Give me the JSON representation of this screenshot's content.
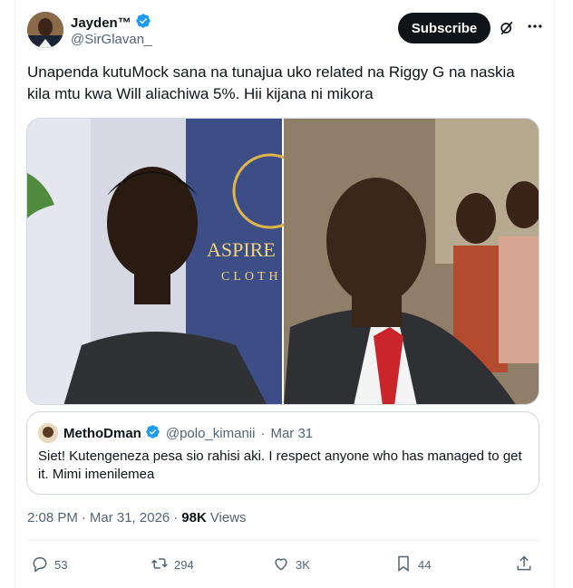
{
  "author": {
    "display_name": "Jayden™",
    "handle": "@SirGlavan_",
    "verified_icon": "verified-badge-icon"
  },
  "header": {
    "subscribe_label": "Subscribe",
    "grok_icon": "grok-icon",
    "more_icon": "more-icon"
  },
  "tweet": {
    "text": "Unapenda kutuMock sana na tunajua uko related na Riggy G na naskia kila mtu kwa Will aliachiwa 5%. Hii kijana ni mikora"
  },
  "media": {
    "left_sign_line1": "ASPIRE",
    "left_sign_line2": "CLOTH"
  },
  "quote": {
    "display_name": "MethoDman",
    "handle": "@polo_kimanii",
    "separator": "·",
    "date": "Mar 31",
    "text": "Siet! Kutengeneza pesa sio rahisi aki. I respect anyone who has managed to get it. Mimi imenilemea"
  },
  "meta": {
    "time": "2:08 PM",
    "separator1": "·",
    "date": "Mar 31, 2026",
    "separator2": "·",
    "views_count": "98K",
    "views_label": "Views"
  },
  "actions": {
    "replies": "53",
    "reposts": "294",
    "likes": "3K",
    "bookmarks": "44"
  },
  "colors": {
    "text": "#0f1419",
    "secondary": "#536471",
    "verified": "#1d9bf0",
    "border": "#cfd9de"
  }
}
